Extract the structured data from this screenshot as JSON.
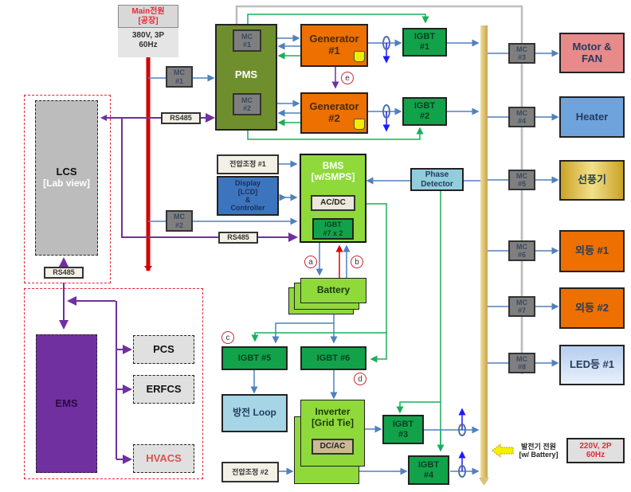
{
  "main_power": {
    "title": "Main전원\n[공장]",
    "spec": "380V, 3P\n60Hz"
  },
  "pms": {
    "label": "PMS",
    "mc1": "MC\n#1",
    "mc2": "MC\n#2"
  },
  "mc_left": {
    "mc1": "MC\n#1",
    "mc2": "MC\n#2"
  },
  "generators": [
    {
      "label": "Generator\n#1"
    },
    {
      "label": "Generator\n#2"
    }
  ],
  "igbts": {
    "igbt1": "IGBT\n#1",
    "igbt2": "IGBT\n#2",
    "igbt3": "IGBT\n#3",
    "igbt4": "IGBT\n#4",
    "igbt5": "IGBT #5",
    "igbt6": "IGBT #6",
    "igbt7": "IGBT\n#7 x 2"
  },
  "rs485_labels": [
    "RS485",
    "RS485",
    "RS485"
  ],
  "lcs": {
    "title": "LCS",
    "subtitle": "[Lab view]"
  },
  "ems": {
    "title": "EMS"
  },
  "subsystems": [
    {
      "label": "PCS",
      "color": "#111111"
    },
    {
      "label": "ERFCS",
      "color": "#111111"
    },
    {
      "label": "HVACS",
      "color": "#d9534f"
    }
  ],
  "voltage_adjust": [
    "전압조정 #1",
    "전압조정 #2"
  ],
  "display": "Display\n[LCD]\n&\nController",
  "bms": {
    "title": "BMS\n[w/SMPS]",
    "acdc": "AC/DC"
  },
  "phase_detector": "Phase\nDetector",
  "battery": "Battery",
  "discharge_loop": "방전 Loop",
  "inverter": {
    "title": "Inverter\n[Grid Tie]",
    "dcac": "DC/AC"
  },
  "markers": [
    "a",
    "b",
    "c",
    "d",
    "e"
  ],
  "right_mcs": [
    "MC\n#3",
    "MC\n#4",
    "MC\n#5",
    "MC\n#6",
    "MC\n#7",
    "MC\n#8"
  ],
  "loads": [
    {
      "label": "Motor &\nFAN",
      "bg": "#e8898a"
    },
    {
      "label": "Heater",
      "bg": "#6fa3dc"
    },
    {
      "label": "선풍기",
      "bg": "#d9b82e"
    },
    {
      "label": "외등 #1",
      "bg": "#ed7000"
    },
    {
      "label": "외등 #2",
      "bg": "#ed7000"
    },
    {
      "label": "LED등 #1",
      "bg": "#d7e4f7"
    }
  ],
  "gen_power": {
    "label": "발전기 전원\n[w/ Battery]",
    "spec": "220V, 2P\n60Hz"
  },
  "colors": {
    "main_bus": "#d40000",
    "rs485": "#7030a0",
    "control": "#18b05a",
    "power": "#4f81bd",
    "ac_bus": "#d9c27a"
  }
}
